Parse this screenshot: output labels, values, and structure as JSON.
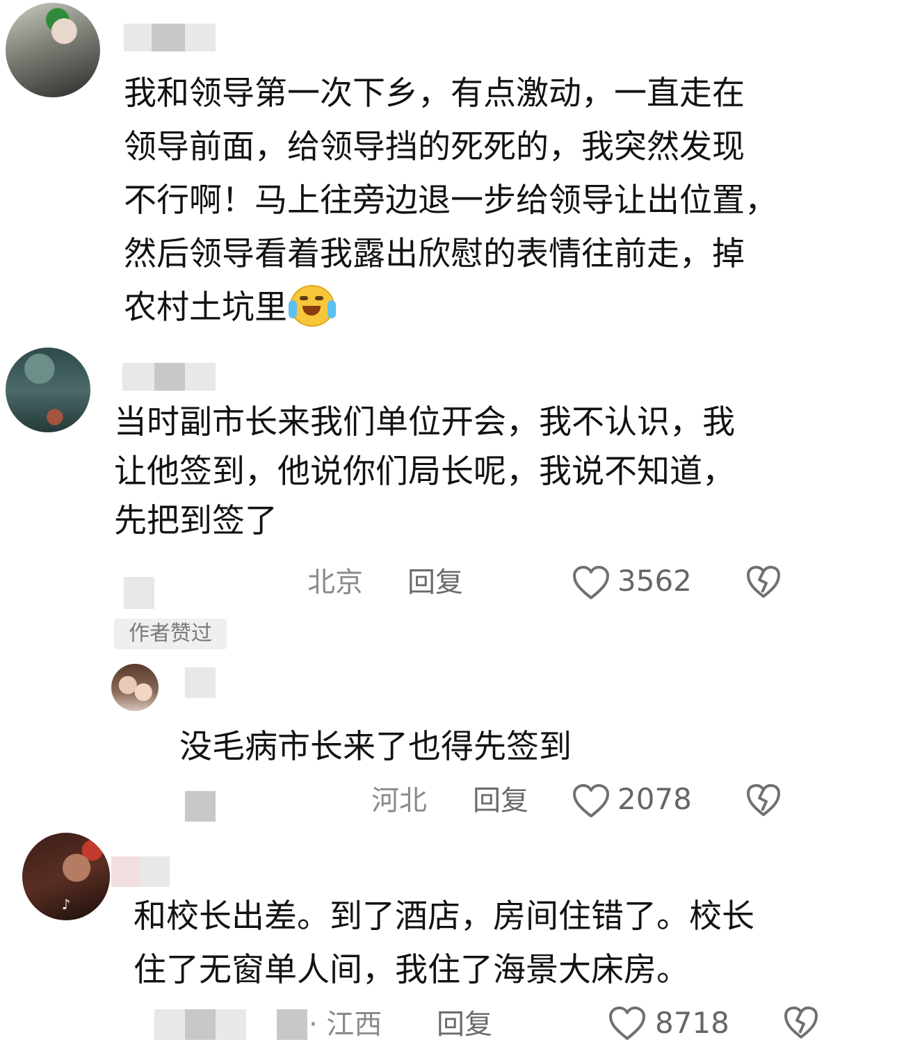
{
  "comments": [
    {
      "text": "我和领导第一次下乡，有点激动，一直走在\n领导前面，给领导挡的死死的，我突然发现\n不行啊！马上往旁边退一步给领导让出位置，\n然后领导看着我露出欣慰的表情往前走，掉\n农村土坑里"
    },
    {
      "text": "当时副市长来我们单位开会，我不认识，我\n让他签到，他说你们局长呢，我说不知道，\n先把到签了",
      "location": "北京",
      "reply_label": "回复",
      "likes": "3562",
      "badge": "作者赞过"
    },
    {
      "text": "没毛病市长来了也得先签到",
      "location": "河北",
      "reply_label": "回复",
      "likes": "2078"
    },
    {
      "text": "和校长出差。到了酒店，房间住错了。校长\n住了无窗单人间，我住了海景大床房。",
      "location": "· 江西",
      "reply_label": "回复",
      "likes": "8718"
    }
  ],
  "icons": {
    "like": "heart-outline-icon",
    "dislike": "broken-heart-icon",
    "emoji": "crying-laughing-emoji",
    "app_mark": "tiktok-icon"
  },
  "colors": {
    "text": "#121212",
    "meta": "#8a8a8a",
    "badge_bg": "#efefef"
  }
}
